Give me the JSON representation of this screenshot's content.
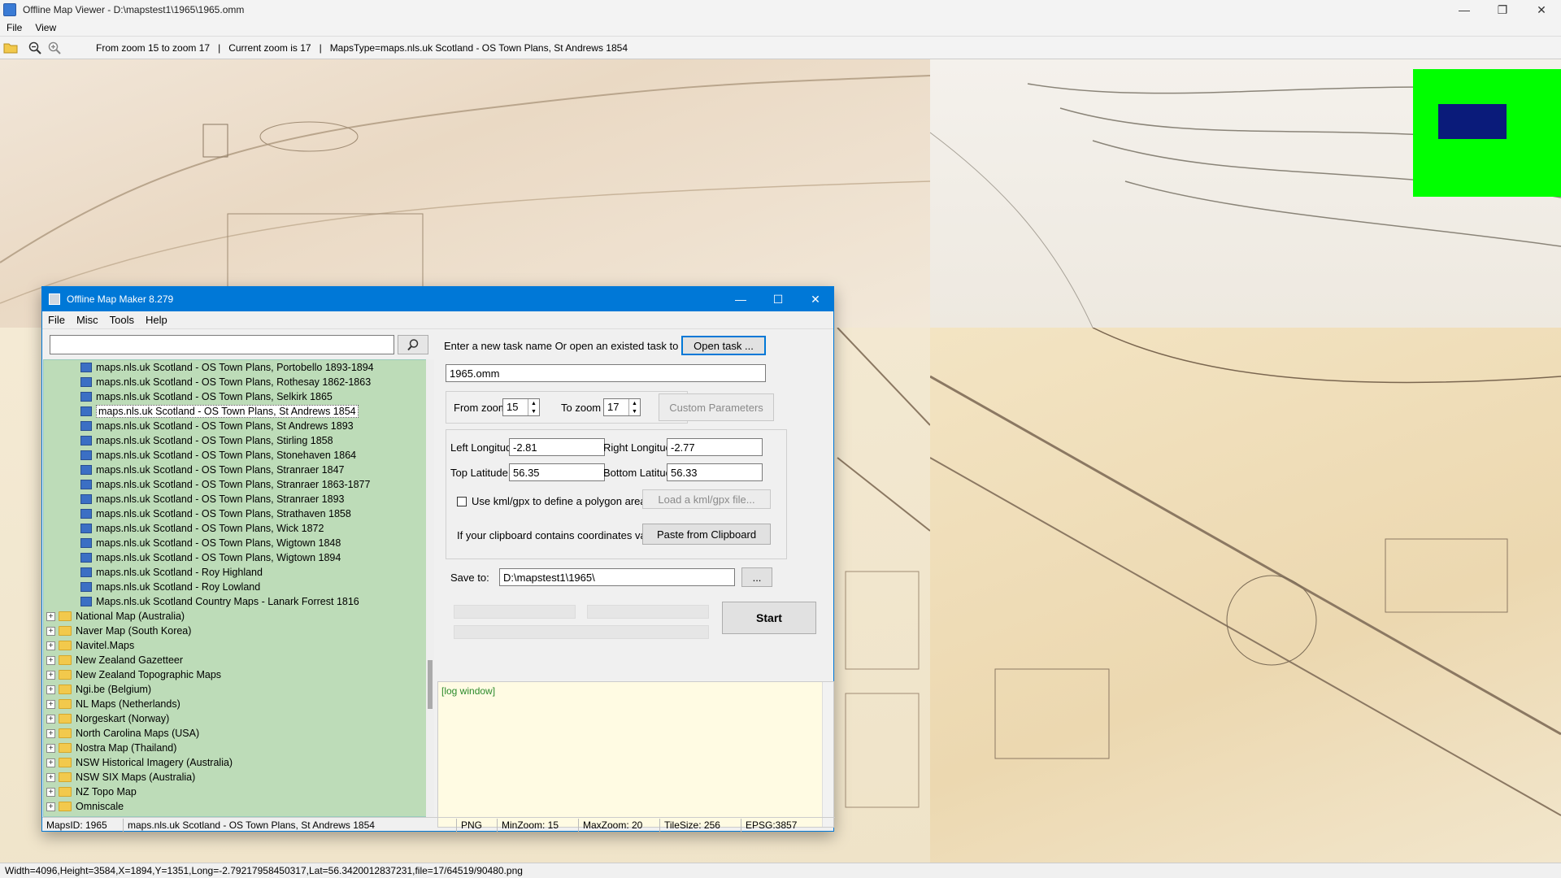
{
  "window": {
    "title": "Offline Map Viewer - D:\\mapstest1\\1965\\1965.omm",
    "controls": {
      "minimize": "—",
      "maximize": "❐",
      "close": "✕"
    }
  },
  "menu": [
    "File",
    "View"
  ],
  "toolbar": {
    "zoom_range": "From zoom 15 to zoom 17",
    "sep1": "|",
    "current_zoom": "Current zoom is 17",
    "sep2": "|",
    "maps_type": "MapsType=maps.nls.uk Scotland - OS Town Plans, St Andrews 1854"
  },
  "status_bar": "Width=4096,Height=3584,X=1894,Y=1351,Long=-2.79217958450317,Lat=56.3420012837231,file=17/64519/90480.png",
  "dialog": {
    "title": "Offline Map Maker 8.279",
    "controls": {
      "minimize": "—",
      "maximize": "☐",
      "close": "✕"
    },
    "menu": [
      "File",
      "Misc",
      "Tools",
      "Help"
    ],
    "search": {
      "value": "",
      "icon": "magnifier-icon"
    },
    "tree": [
      {
        "type": "leaf",
        "label": "maps.nls.uk Scotland - OS Town Plans, Portobello 1893-1894"
      },
      {
        "type": "leaf",
        "label": "maps.nls.uk Scotland - OS Town Plans, Rothesay 1862-1863"
      },
      {
        "type": "leaf",
        "label": "maps.nls.uk Scotland - OS Town Plans, Selkirk 1865"
      },
      {
        "type": "leaf",
        "label": "maps.nls.uk Scotland - OS Town Plans, St Andrews 1854",
        "selected": true
      },
      {
        "type": "leaf",
        "label": "maps.nls.uk Scotland - OS Town Plans, St Andrews 1893"
      },
      {
        "type": "leaf",
        "label": "maps.nls.uk Scotland - OS Town Plans, Stirling 1858"
      },
      {
        "type": "leaf",
        "label": "maps.nls.uk Scotland - OS Town Plans, Stonehaven 1864"
      },
      {
        "type": "leaf",
        "label": "maps.nls.uk Scotland - OS Town Plans, Stranraer 1847"
      },
      {
        "type": "leaf",
        "label": "maps.nls.uk Scotland - OS Town Plans, Stranraer 1863-1877"
      },
      {
        "type": "leaf",
        "label": "maps.nls.uk Scotland - OS Town Plans, Stranraer 1893"
      },
      {
        "type": "leaf",
        "label": "maps.nls.uk Scotland - OS Town Plans, Strathaven 1858"
      },
      {
        "type": "leaf",
        "label": "maps.nls.uk Scotland - OS Town Plans, Wick 1872"
      },
      {
        "type": "leaf",
        "label": "maps.nls.uk Scotland - OS Town Plans, Wigtown 1848"
      },
      {
        "type": "leaf",
        "label": "maps.nls.uk Scotland - OS Town Plans, Wigtown 1894"
      },
      {
        "type": "leaf",
        "label": "maps.nls.uk Scotland - Roy Highland"
      },
      {
        "type": "leaf",
        "label": "maps.nls.uk Scotland - Roy Lowland"
      },
      {
        "type": "leaf",
        "label": "Maps.nls.uk Scotland Country Maps - Lanark Forrest 1816"
      },
      {
        "type": "folder",
        "label": "National Map (Australia)"
      },
      {
        "type": "folder",
        "label": "Naver Map (South Korea)"
      },
      {
        "type": "folder",
        "label": "Navitel.Maps"
      },
      {
        "type": "folder",
        "label": "New Zealand Gazetteer"
      },
      {
        "type": "folder",
        "label": "New Zealand Topographic Maps"
      },
      {
        "type": "folder",
        "label": "Ngi.be (Belgium)"
      },
      {
        "type": "folder",
        "label": "NL Maps (Netherlands)"
      },
      {
        "type": "folder",
        "label": "Norgeskart (Norway)"
      },
      {
        "type": "folder",
        "label": "North Carolina Maps (USA)"
      },
      {
        "type": "folder",
        "label": "Nostra Map (Thailand)"
      },
      {
        "type": "folder",
        "label": "NSW Historical Imagery (Australia)"
      },
      {
        "type": "folder",
        "label": "NSW SIX Maps (Australia)"
      },
      {
        "type": "folder",
        "label": "NZ Topo Map"
      },
      {
        "type": "folder",
        "label": "Omniscale"
      }
    ],
    "task": {
      "prompt": "Enter a new task name Or open an existed task to continue:",
      "open_button": "Open task ...",
      "name_value": "1965.omm"
    },
    "zoom": {
      "from_label": "From zoom",
      "from_value": "15",
      "to_label": "To zoom",
      "to_value": "17",
      "custom_button": "Custom Parameters"
    },
    "bounds": {
      "left_lon_label": "Left Longitude",
      "left_lon": "-2.81",
      "right_lon_label": "Right Longitude",
      "right_lon": "-2.77",
      "top_lat_label": "Top Latitude",
      "top_lat": "56.35",
      "bottom_lat_label": "Bottom Latitude",
      "bottom_lat": "56.33",
      "kml_checkbox_label": "Use kml/gpx to define a polygon area",
      "kml_checked": false,
      "kml_button": "Load a kml/gpx file...",
      "clipboard_label": "If your clipboard contains coordinates values:",
      "clipboard_button": "Paste from Clipboard"
    },
    "save": {
      "label": "Save to:",
      "path": "D:\\mapstest1\\1965\\",
      "browse_button": "..."
    },
    "start_button": "Start",
    "log_text": "[log window]",
    "status": {
      "maps_id": "MapsID: 1965",
      "map_name": "maps.nls.uk Scotland - OS Town Plans, St Andrews 1854",
      "format": "PNG",
      "min_zoom": "MinZoom: 15",
      "max_zoom": "MaxZoom: 20",
      "tile_size": "TileSize: 256",
      "epsg": "EPSG:3857"
    }
  },
  "colors": {
    "dialog_accent": "#0078d7",
    "tree_bg": "#bddcb8",
    "overview_bg": "#00ff00",
    "overview_box": "#0a1b7a",
    "log_text": "#2b8a2b"
  }
}
